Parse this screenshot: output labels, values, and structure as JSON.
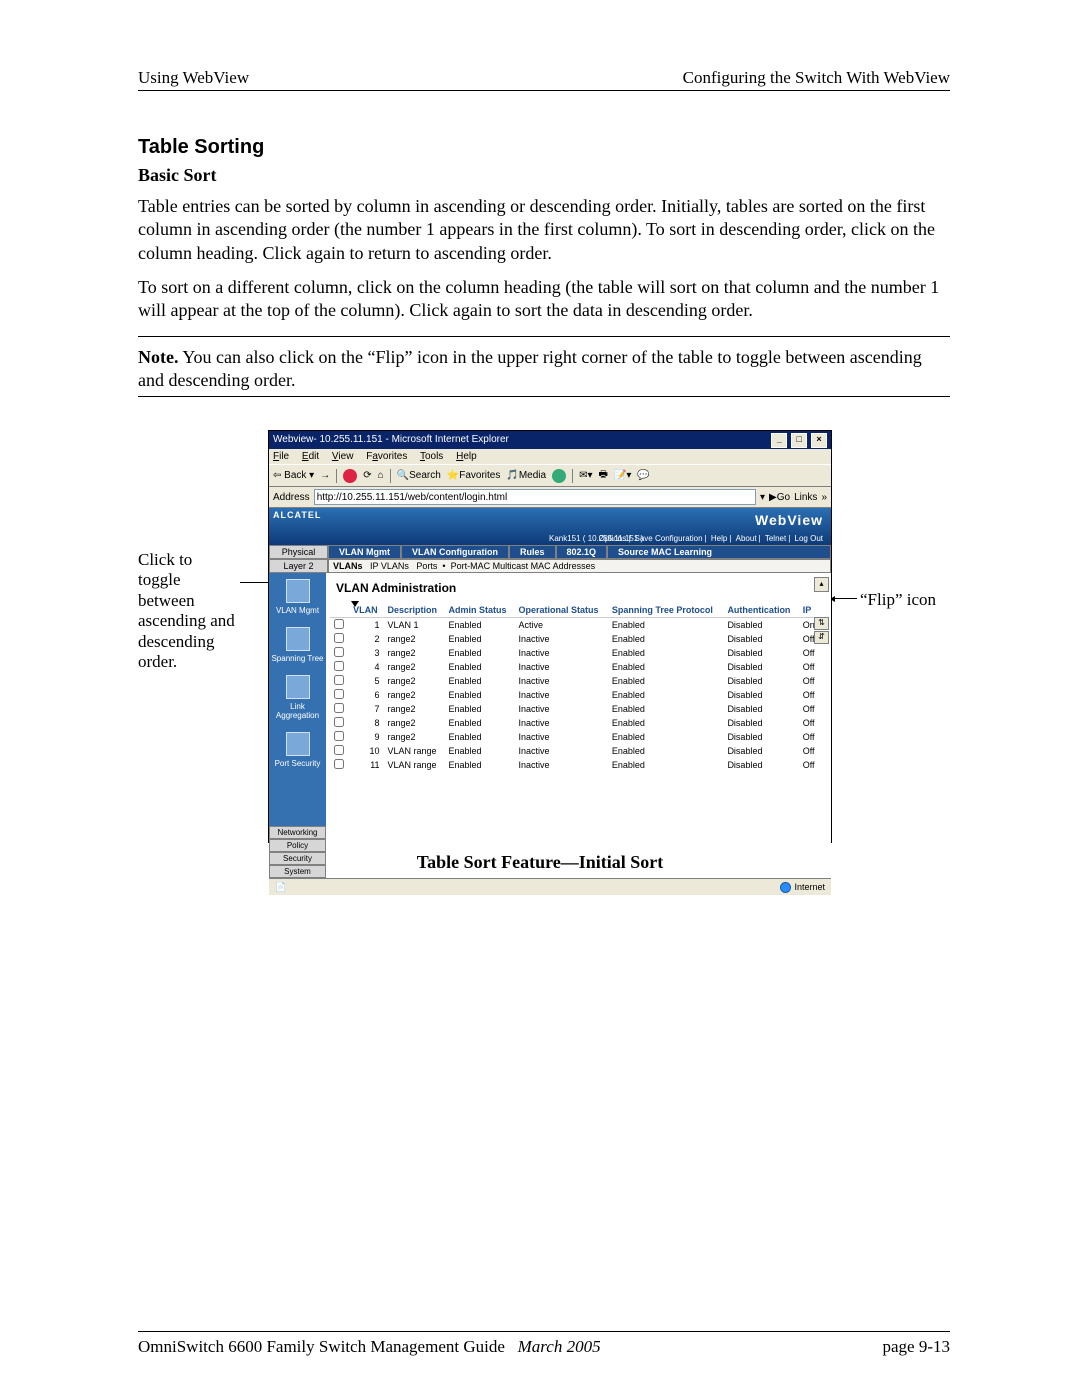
{
  "header": {
    "left": "Using WebView",
    "right": "Configuring the Switch With WebView"
  },
  "section": {
    "title": "Table Sorting",
    "subtitle": "Basic Sort",
    "para1": "Table entries can be sorted by column in ascending or descending order. Initially, tables are sorted on the first column in ascending order (the number 1 appears in the first column). To sort in descending order, click on the column heading. Click again to return to ascending order.",
    "para2": "To sort on a different column, click on the column heading (the table will sort on that column and the number 1 will appear at the top of the column). Click again to sort the data in descending order.",
    "note_label": "Note.",
    "note_text": " You can also click on the “Flip” icon in the upper right corner of the table to toggle between ascending and descending order."
  },
  "callouts": {
    "left": "Click to toggle between ascending and descending order.",
    "right": "“Flip” icon"
  },
  "caption": "Table Sort Feature—Initial Sort",
  "browser": {
    "title": "Webview- 10.255.11.151 - Microsoft Internet Explorer",
    "menus": [
      "File",
      "Edit",
      "View",
      "Favorites",
      "Tools",
      "Help"
    ],
    "toolbar": {
      "back": "Back",
      "search": "Search",
      "favorites": "Favorites",
      "media": "Media"
    },
    "address_label": "Address",
    "address_value": "http://10.255.11.151/web/content/login.html",
    "go": "Go",
    "links": "Links",
    "brand": "WebView",
    "host": "Kank151  ( 10.255.11.151 )",
    "options": [
      "Options",
      "Save Configuration",
      "Help",
      "About",
      "Telnet",
      "Log Out"
    ],
    "crumb": {
      "physical": "Physical",
      "vlan_mgmt": "VLAN Mgmt",
      "vlan_conf": "VLAN Configuration",
      "rules": "Rules",
      "dot1q": "802.1Q",
      "smac": "Source MAC Learning"
    },
    "layer2_label": "Layer 2",
    "subnav": [
      "VLANs",
      "IP VLANs",
      "Ports",
      "Port-MAC Multicast MAC Addresses"
    ],
    "sidebar": [
      {
        "label": "VLAN Mgmt"
      },
      {
        "label": "Spanning Tree"
      },
      {
        "label": "Link Aggregation"
      },
      {
        "label": "Port Security"
      }
    ],
    "sidebar_bottom": [
      "Networking",
      "Policy",
      "Security",
      "System"
    ],
    "content_title": "VLAN Administration",
    "table": {
      "columns": [
        "",
        "VLAN",
        "Description",
        "Admin Status",
        "Operational Status",
        "Spanning Tree Protocol",
        "Authentication",
        "IP"
      ],
      "rows": [
        {
          "vlan": 1,
          "desc": "VLAN 1",
          "admin": "Enabled",
          "op": "Active",
          "stp": "Enabled",
          "auth": "Disabled",
          "ip": "On"
        },
        {
          "vlan": 2,
          "desc": "range2",
          "admin": "Enabled",
          "op": "Inactive",
          "stp": "Enabled",
          "auth": "Disabled",
          "ip": "Off"
        },
        {
          "vlan": 3,
          "desc": "range2",
          "admin": "Enabled",
          "op": "Inactive",
          "stp": "Enabled",
          "auth": "Disabled",
          "ip": "Off"
        },
        {
          "vlan": 4,
          "desc": "range2",
          "admin": "Enabled",
          "op": "Inactive",
          "stp": "Enabled",
          "auth": "Disabled",
          "ip": "Off"
        },
        {
          "vlan": 5,
          "desc": "range2",
          "admin": "Enabled",
          "op": "Inactive",
          "stp": "Enabled",
          "auth": "Disabled",
          "ip": "Off"
        },
        {
          "vlan": 6,
          "desc": "range2",
          "admin": "Enabled",
          "op": "Inactive",
          "stp": "Enabled",
          "auth": "Disabled",
          "ip": "Off"
        },
        {
          "vlan": 7,
          "desc": "range2",
          "admin": "Enabled",
          "op": "Inactive",
          "stp": "Enabled",
          "auth": "Disabled",
          "ip": "Off"
        },
        {
          "vlan": 8,
          "desc": "range2",
          "admin": "Enabled",
          "op": "Inactive",
          "stp": "Enabled",
          "auth": "Disabled",
          "ip": "Off"
        },
        {
          "vlan": 9,
          "desc": "range2",
          "admin": "Enabled",
          "op": "Inactive",
          "stp": "Enabled",
          "auth": "Disabled",
          "ip": "Off"
        },
        {
          "vlan": 10,
          "desc": "VLAN range",
          "admin": "Enabled",
          "op": "Inactive",
          "stp": "Enabled",
          "auth": "Disabled",
          "ip": "Off"
        },
        {
          "vlan": 11,
          "desc": "VLAN range",
          "admin": "Enabled",
          "op": "Inactive",
          "stp": "Enabled",
          "auth": "Disabled",
          "ip": "Off"
        }
      ]
    },
    "status_internet": "Internet"
  },
  "footer": {
    "guide": "OmniSwitch 6600 Family Switch Management Guide",
    "date": "March 2005",
    "page": "page 9-13"
  }
}
